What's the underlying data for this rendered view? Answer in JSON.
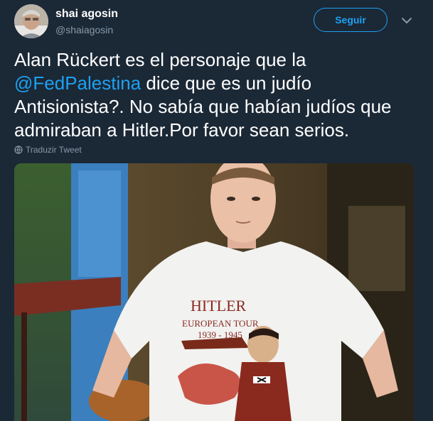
{
  "author": {
    "name": "shai agosin",
    "handle": "@shaiagosin"
  },
  "follow_label": "Seguir",
  "tweet": {
    "text_line1_a": "Alan Rückert es el personaje que la",
    "mention": "@FedPalestina",
    "text_line2_b": " dice que es un judío",
    "text_rest": "Antisionista?. No sabía que habían judíos que admiraban a Hitler.Por favor sean serios."
  },
  "translate_label": "Traduzir Tweet",
  "media": {
    "shirt_title": "HITLER",
    "shirt_sub": "EUROPEAN TOUR",
    "shirt_years": "1939 - 1945"
  },
  "colors": {
    "background": "#1b2836",
    "accent": "#1da1f2",
    "muted": "#8899a6"
  },
  "icons": [
    "chevron-down-icon",
    "globe-icon"
  ]
}
